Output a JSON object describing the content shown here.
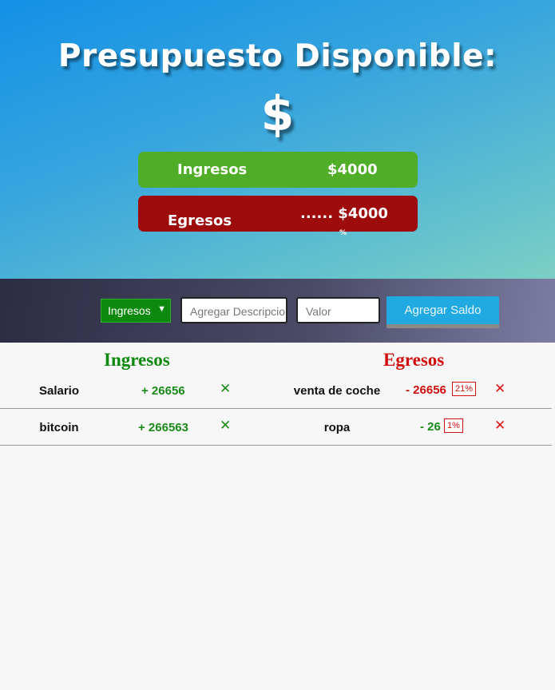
{
  "header": {
    "title": "Presupuesto Disponible:",
    "amount_symbol": "$",
    "ingresos": {
      "label": "Ingresos",
      "value": "$4000"
    },
    "egresos": {
      "label": "Egresos",
      "value": "...... $4000",
      "percent": "%"
    }
  },
  "form": {
    "type_select": {
      "selected": "Ingresos",
      "options": [
        "Ingresos"
      ]
    },
    "description_placeholder": "Agregar Descripcion",
    "value_placeholder": "Valor",
    "submit_label": "Agregar Saldo"
  },
  "lists": {
    "ingresos_title": "Ingresos",
    "egresos_title": "Egresos",
    "ingresos": [
      {
        "description": "Salario",
        "value": "+ 26656"
      },
      {
        "description": "bitcoin",
        "value": "+ 266563"
      }
    ],
    "egresos": [
      {
        "description": "venta de coche",
        "value": "- 26656",
        "percent": "21%"
      },
      {
        "description": "ropa",
        "value": "- 26",
        "percent": "1%"
      }
    ],
    "delete_glyph": "✕"
  },
  "colors": {
    "ingresos_accent": "#4fad27",
    "egresos_accent": "#9e0b0b",
    "button": "#21a9e1"
  }
}
